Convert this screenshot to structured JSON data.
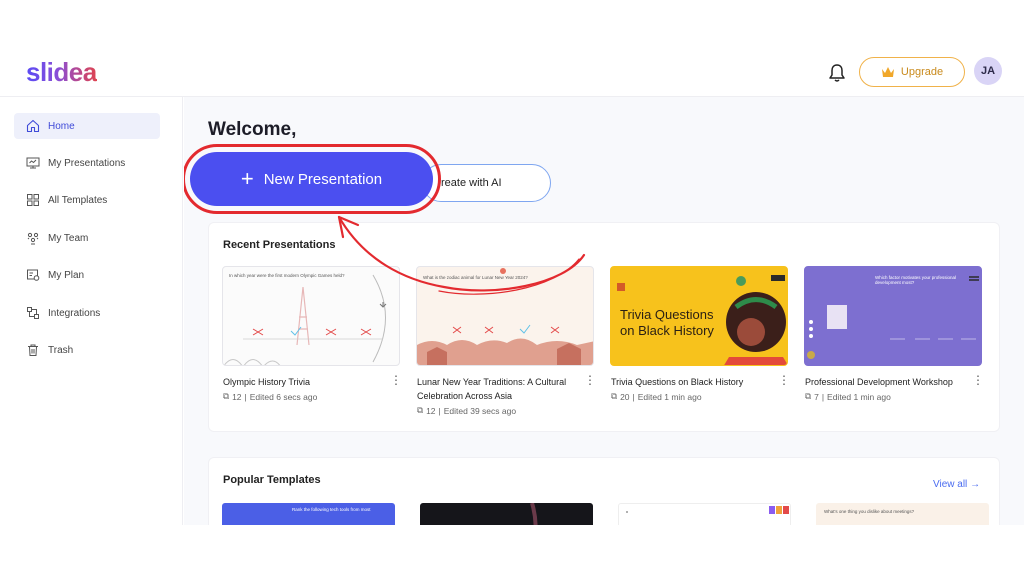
{
  "app": {
    "logo": "slidea"
  },
  "header": {
    "upgrade_label": "Upgrade",
    "avatar_initials": "JA"
  },
  "sidebar": {
    "items": [
      {
        "label": "Home",
        "icon": "home-icon",
        "active": true
      },
      {
        "label": "My Presentations",
        "icon": "presentation-icon"
      },
      {
        "label": "All Templates",
        "icon": "grid-icon"
      },
      {
        "label": "My Team",
        "icon": "team-icon"
      },
      {
        "label": "My Plan",
        "icon": "plan-icon"
      },
      {
        "label": "Integrations",
        "icon": "integrations-icon"
      },
      {
        "label": "Trash",
        "icon": "trash-icon"
      }
    ]
  },
  "main": {
    "welcome": "Welcome,",
    "new_presentation_label": "New Presentation",
    "create_ai_label": "reate with AI",
    "recent": {
      "title": "Recent Presentations",
      "cards": [
        {
          "title": "Olympic History Trivia",
          "count": "12",
          "edited": "Edited 6 secs ago",
          "thumb_text": "In which year were the first modern Olympic Games held?"
        },
        {
          "title": "Lunar New Year Traditions: A Cultural Celebration Across Asia",
          "count": "12",
          "edited": "Edited 39 secs ago",
          "thumb_text": "What is the zodiac animal for Lunar New Year 2024?"
        },
        {
          "title": "Trivia Questions on Black History",
          "count": "20",
          "edited": "Edited 1 min ago",
          "thumb_text": "Trivia Questions on Black History"
        },
        {
          "title": "Professional Development Workshop",
          "count": "7",
          "edited": "Edited 1 min ago",
          "thumb_text": "Which factor motivates your professional development most?"
        }
      ]
    },
    "popular": {
      "title": "Popular Templates",
      "view_all": "View all",
      "thumbs": [
        {
          "text": "Rank the following tech tools from most"
        },
        {
          "text": ""
        },
        {
          "text": ""
        },
        {
          "text": "What's one thing you dislike about meetings?"
        }
      ]
    }
  },
  "colors": {
    "primary": "#4b4ff0",
    "highlight_red": "#e32a2f",
    "upgrade_orange": "#f0b24a",
    "trivia_yellow": "#f7c21c",
    "workshop_purple": "#7d6fd0"
  }
}
